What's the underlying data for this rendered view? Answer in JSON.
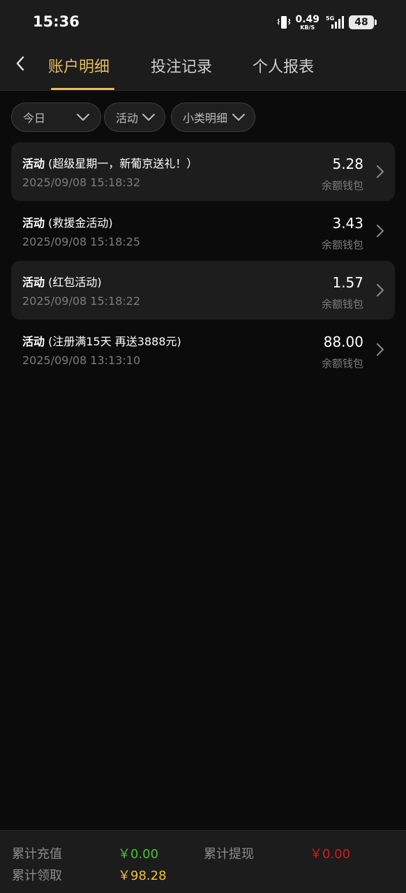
{
  "status_bar": {
    "time": "15:36",
    "net_speed": "0.49",
    "net_unit": "KB/S",
    "network_type": "5G",
    "battery": "48"
  },
  "header": {
    "tabs": [
      {
        "label": "账户明细",
        "active": true
      },
      {
        "label": "投注记录",
        "active": false
      },
      {
        "label": "个人报表",
        "active": false
      }
    ]
  },
  "filters": [
    {
      "label": "今日"
    },
    {
      "label": "活动"
    },
    {
      "label": "小类明细"
    }
  ],
  "records": [
    {
      "category": "活动",
      "detail": "(超级星期一，新葡京送礼！）",
      "time": "2025/09/08 15:18:32",
      "amount": "5.28",
      "wallet": "余额钱包"
    },
    {
      "category": "活动",
      "detail": "(救援金活动)",
      "time": "2025/09/08 15:18:25",
      "amount": "3.43",
      "wallet": "余额钱包"
    },
    {
      "category": "活动",
      "detail": "(红包活动)",
      "time": "2025/09/08 15:18:22",
      "amount": "1.57",
      "wallet": "余额钱包"
    },
    {
      "category": "活动",
      "detail": "(注册满15天 再送3888元)",
      "time": "2025/09/08 13:13:10",
      "amount": "88.00",
      "wallet": "余额钱包"
    }
  ],
  "summary": {
    "deposit_label": "累计充值",
    "deposit_value": "￥0.00",
    "withdraw_label": "累计提现",
    "withdraw_value": "￥0.00",
    "claim_label": "累计领取",
    "claim_value": "￥98.28"
  },
  "colors": {
    "accent": "#e7bf5f",
    "deposit": "#4cbf3a",
    "withdraw": "#d01c1c",
    "claim": "#f2c230"
  }
}
